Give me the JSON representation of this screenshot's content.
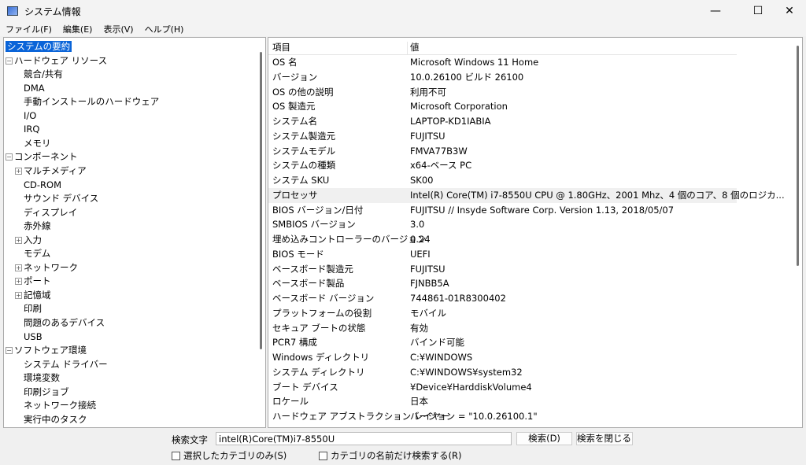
{
  "window": {
    "title": "システム情報",
    "minimize": "—",
    "maximize": "☐",
    "close": "✕"
  },
  "menu": [
    "ファイル(F)",
    "編集(E)",
    "表示(V)",
    "ヘルプ(H)"
  ],
  "tree": [
    {
      "label": "システムの要約",
      "level": 0,
      "selected": true
    },
    {
      "label": "ハードウェア リソース",
      "level": 0,
      "expander": "−"
    },
    {
      "label": "競合/共有",
      "level": 1
    },
    {
      "label": "DMA",
      "level": 1
    },
    {
      "label": "手動インストールのハードウェア",
      "level": 1
    },
    {
      "label": "I/O",
      "level": 1
    },
    {
      "label": "IRQ",
      "level": 1
    },
    {
      "label": "メモリ",
      "level": 1
    },
    {
      "label": "コンポーネント",
      "level": 0,
      "expander": "−"
    },
    {
      "label": "マルチメディア",
      "level": 1,
      "expander": "+"
    },
    {
      "label": "CD-ROM",
      "level": 1
    },
    {
      "label": "サウンド デバイス",
      "level": 1
    },
    {
      "label": "ディスプレイ",
      "level": 1
    },
    {
      "label": "赤外線",
      "level": 1
    },
    {
      "label": "入力",
      "level": 1,
      "expander": "+"
    },
    {
      "label": "モデム",
      "level": 1
    },
    {
      "label": "ネットワーク",
      "level": 1,
      "expander": "+"
    },
    {
      "label": "ポート",
      "level": 1,
      "expander": "+"
    },
    {
      "label": "記憶域",
      "level": 1,
      "expander": "+"
    },
    {
      "label": "印刷",
      "level": 1
    },
    {
      "label": "問題のあるデバイス",
      "level": 1
    },
    {
      "label": "USB",
      "level": 1
    },
    {
      "label": "ソフトウェア環境",
      "level": 0,
      "expander": "−"
    },
    {
      "label": "システム ドライバー",
      "level": 1
    },
    {
      "label": "環境変数",
      "level": 1
    },
    {
      "label": "印刷ジョブ",
      "level": 1
    },
    {
      "label": "ネットワーク接続",
      "level": 1
    },
    {
      "label": "実行中のタスク",
      "level": 1
    }
  ],
  "table": {
    "headers": [
      "項目",
      "値"
    ],
    "rows": [
      [
        "OS 名",
        "Microsoft Windows 11 Home"
      ],
      [
        "バージョン",
        "10.0.26100 ビルド 26100"
      ],
      [
        "OS の他の説明",
        "利用不可"
      ],
      [
        "OS 製造元",
        "Microsoft Corporation"
      ],
      [
        "システム名",
        "LAPTOP-KD1IABIA"
      ],
      [
        "システム製造元",
        "FUJITSU"
      ],
      [
        "システムモデル",
        "FMVA77B3W"
      ],
      [
        "システムの種類",
        "x64-ベース PC"
      ],
      [
        "システム SKU",
        "SK00"
      ],
      [
        "プロセッサ",
        "Intel(R) Core(TM) i7-8550U CPU @ 1.80GHz、2001 Mhz、4 個のコア、8 個のロジカ..."
      ],
      [
        "BIOS バージョン/日付",
        "FUJITSU // Insyde Software Corp. Version 1.13, 2018/05/07"
      ],
      [
        "SMBIOS バージョン",
        "3.0"
      ],
      [
        "埋め込みコントローラーのバージョン",
        "0.24"
      ],
      [
        "BIOS モード",
        "UEFI"
      ],
      [
        "ベースボード製造元",
        "FUJITSU"
      ],
      [
        "ベースボード製品",
        "FJNBB5A"
      ],
      [
        "ベースボード バージョン",
        "744861-01R8300402"
      ],
      [
        "プラットフォームの役割",
        "モバイル"
      ],
      [
        "セキュア ブートの状態",
        "有効"
      ],
      [
        "PCR7 構成",
        "バインド可能"
      ],
      [
        "Windows ディレクトリ",
        "C:¥WINDOWS"
      ],
      [
        "システム ディレクトリ",
        "C:¥WINDOWS¥system32"
      ],
      [
        "ブート デバイス",
        "¥Device¥HarddiskVolume4"
      ],
      [
        "ロケール",
        "日本"
      ],
      [
        "ハードウェア アブストラクション レイヤー",
        "バージョン = \"10.0.26100.1\""
      ]
    ],
    "highlighted_row": 9
  },
  "search": {
    "label": "検索文字",
    "value": "intel(R)Core(TM)i7-8550U",
    "find_button": "検索(D)",
    "close_button": "検索を閉じる(C",
    "only_selected": "選択したカテゴリのみ(S)",
    "names_only": "カテゴリの名前だけ検索する(R)"
  }
}
